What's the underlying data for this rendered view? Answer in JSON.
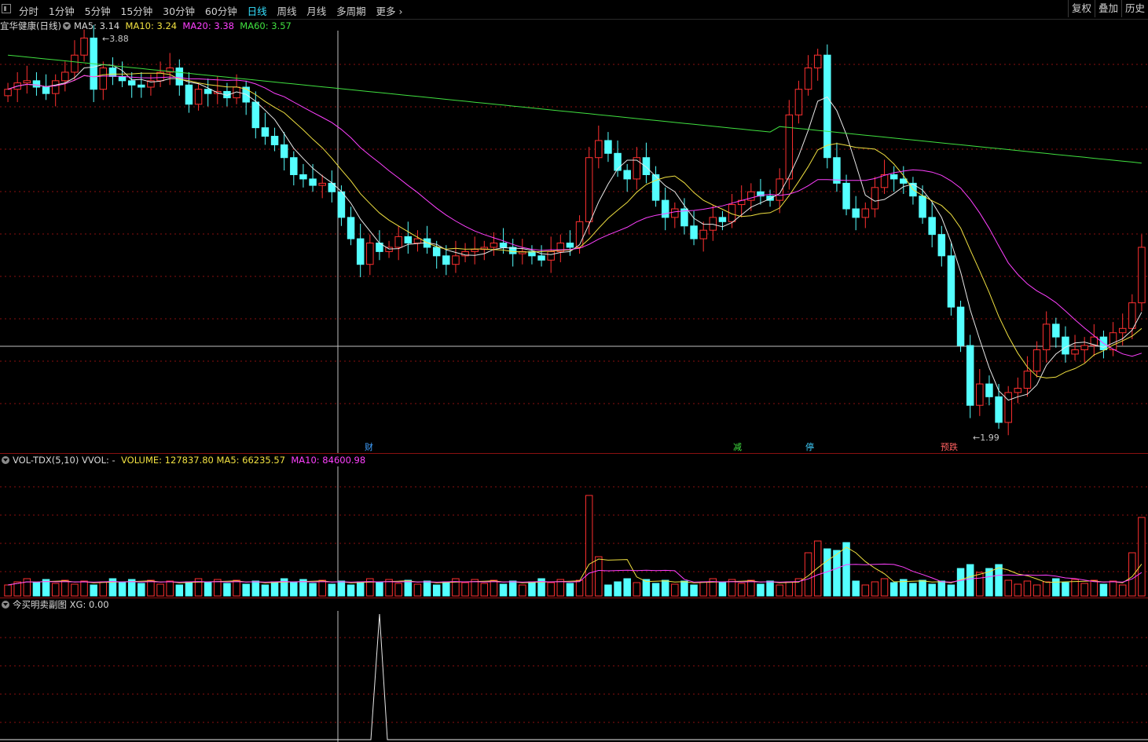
{
  "toolbar": {
    "tabs": [
      "分时",
      "1分钟",
      "5分钟",
      "15分钟",
      "30分钟",
      "60分钟",
      "日线",
      "周线",
      "月线",
      "多周期",
      "更多"
    ],
    "active_tab": "日线",
    "right_buttons": [
      "复权",
      "叠加",
      "历史"
    ]
  },
  "main_panel": {
    "title": "宜华健康(日线)",
    "indicators": [
      {
        "label": "MA5: 3.14",
        "color": "#d8d8d8"
      },
      {
        "label": "MA10: 3.24",
        "color": "#f0e040"
      },
      {
        "label": "MA20: 3.38",
        "color": "#ff40ff"
      },
      {
        "label": "MA60: 3.57",
        "color": "#40e040"
      }
    ],
    "high_marker": "3.88",
    "low_marker": "1.99",
    "events": [
      {
        "text": "财",
        "color": "#40a0ff"
      },
      {
        "text": "减",
        "color": "#40e040"
      },
      {
        "text": "停",
        "color": "#40d0ff"
      },
      {
        "text": "预跌",
        "color": "#ff6060"
      }
    ]
  },
  "volume_panel": {
    "title": "VOL-TDX(5,10)",
    "vvol": "VVOL: -",
    "volume": "VOLUME: 127837.80",
    "ma5": "MA5: 66235.57",
    "ma10": "MA10: 84600.98"
  },
  "sub_panel": {
    "title": "今买明卖副图",
    "xg": "XG: 0.00"
  },
  "colors": {
    "up": "#ff3030",
    "down": "#54ffff",
    "ma5": "#e8e8e8",
    "ma10": "#f0e040",
    "ma20": "#ff40ff",
    "ma60": "#40e040",
    "grid": "#8a1010"
  },
  "chart_data": {
    "type": "candlestick",
    "price_range": [
      1.99,
      3.88
    ],
    "ohlc_closes": [
      3.62,
      3.65,
      3.66,
      3.63,
      3.6,
      3.66,
      3.7,
      3.78,
      3.86,
      3.62,
      3.72,
      3.68,
      3.66,
      3.64,
      3.63,
      3.66,
      3.7,
      3.72,
      3.64,
      3.55,
      3.62,
      3.6,
      3.61,
      3.58,
      3.63,
      3.56,
      3.44,
      3.4,
      3.36,
      3.3,
      3.22,
      3.2,
      3.17,
      3.18,
      3.14,
      3.02,
      2.92,
      2.8,
      2.9,
      2.86,
      2.88,
      2.93,
      2.9,
      2.92,
      2.88,
      2.84,
      2.8,
      2.84,
      2.86,
      2.87,
      2.88,
      2.9,
      2.88,
      2.85,
      2.86,
      2.84,
      2.82,
      2.86,
      2.9,
      2.88,
      3.0,
      3.3,
      3.38,
      3.32,
      3.24,
      3.2,
      3.3,
      3.22,
      3.1,
      3.02,
      3.06,
      2.98,
      2.92,
      2.96,
      3.02,
      3.0,
      3.08,
      3.1,
      3.14,
      3.12,
      3.1,
      3.2,
      3.5,
      3.62,
      3.72,
      3.78,
      3.3,
      3.18,
      3.06,
      3.02,
      3.06,
      3.16,
      3.22,
      3.2,
      3.18,
      3.12,
      3.02,
      2.94,
      2.84,
      2.6,
      2.42,
      2.14,
      2.24,
      2.18,
      2.06,
      2.2,
      2.22,
      2.3,
      2.4,
      2.52,
      2.46,
      2.38,
      2.4,
      2.42,
      2.46,
      2.4,
      2.48,
      2.5,
      2.62,
      2.88
    ],
    "volume_peak_value": 127837.8
  }
}
